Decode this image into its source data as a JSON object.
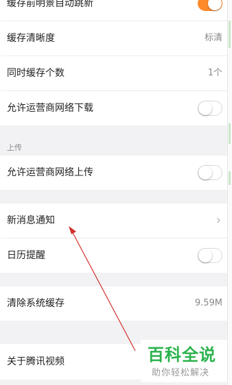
{
  "settings": {
    "top_partial_label": "缓存前明景自动跳新",
    "cache_quality_label": "缓存清晰度",
    "cache_quality_value": "标清",
    "concurrent_cache_label": "同时缓存个数",
    "concurrent_cache_value": "1个",
    "allow_mobile_download_label": "允许运营商网络下载",
    "upload_section_header": "上传",
    "allow_mobile_upload_label": "允许运营商网络上传",
    "new_message_notice_label": "新消息通知",
    "calendar_reminder_label": "日历提醒",
    "clear_cache_label": "清除系统缓存",
    "clear_cache_value": "9.59M",
    "about_label": "关于腾讯视频"
  },
  "toggles": {
    "top_partial": true,
    "allow_mobile_download": false,
    "allow_mobile_upload": false,
    "calendar_reminder": false
  },
  "watermark": {
    "title": "百科全说",
    "subtitle": "助你轻松解决"
  },
  "colors": {
    "toggle_on": "#ff8a29",
    "watermark_green": "#2bb24c",
    "annotation_arrow": "#d0312d"
  }
}
